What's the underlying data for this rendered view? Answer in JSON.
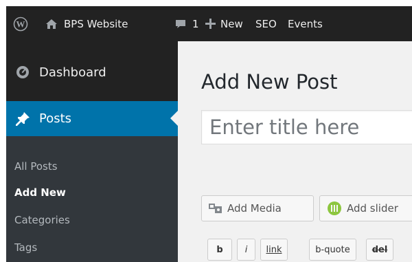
{
  "admin_bar": {
    "site_name": "BPS Website",
    "comments_count": "1",
    "new_label": "New",
    "seo_label": "SEO",
    "events_label": "Events",
    "icons": [
      "wordpress-logo-icon",
      "home-icon",
      "comment-bubble-icon",
      "plus-icon"
    ]
  },
  "sidebar": {
    "dashboard_label": "Dashboard",
    "posts_label": "Posts",
    "submenu": [
      "All Posts",
      "Add New",
      "Categories",
      "Tags"
    ],
    "current_submenu": "Add New"
  },
  "main": {
    "page_title": "Add New Post",
    "title_placeholder": "Enter title here",
    "media_buttons": [
      "Add Media",
      "Add slider"
    ],
    "quicktags": [
      "b",
      "i",
      "link",
      "b-quote",
      "del"
    ]
  },
  "colors": {
    "admin_bg": "#222222",
    "submenu_bg": "#32373c",
    "accent": "#0073aa",
    "content_bg": "#f1f1f1"
  }
}
